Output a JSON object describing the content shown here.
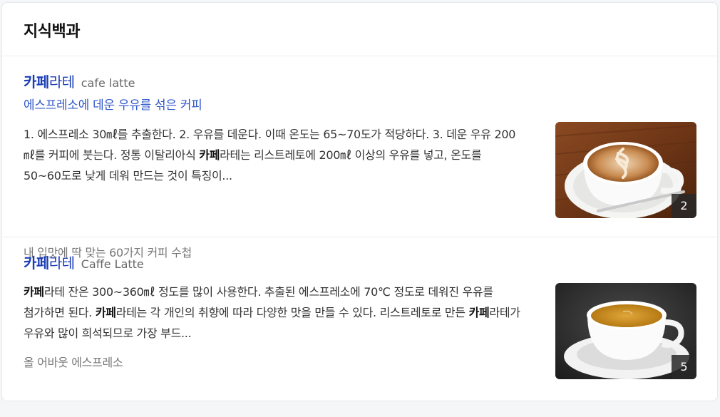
{
  "section_title": "지식백과",
  "items": [
    {
      "title_highlight": "카페",
      "title_rest": "라테",
      "title_sub": "cafe latte",
      "desc": "에스프레소에 데운 우유를 섞은 커피",
      "body": [
        {
          "text": "1. 에스프레소 30㎖를 추출한다. 2. 우유를 데운다. 이때 온도는 65~70도가 적당하다. 3. 데운 우유 200㎖를 커피에 붓는다. 정통 이탈리아식 "
        },
        {
          "text": "카페",
          "bold": true
        },
        {
          "text": "라테는 리스트레토에 200㎖ 이상의 우유를 넣고, 온도를 50~60도로 낮게 데워 만드는 것이 특징이..."
        }
      ],
      "source": "내 입맛에 딱 맞는 60가지 커피 수첩",
      "image_count": "2"
    },
    {
      "title_highlight": "카페",
      "title_rest": "라테",
      "title_sub": "Caffe Latte",
      "desc": "",
      "body": [
        {
          "text": "카페",
          "bold": true
        },
        {
          "text": "라테 잔은 300~360㎖ 정도를 많이 사용한다. 추출된 에스프레소에 70℃ 정도로 데워진 우유를 첨가하면 된다. "
        },
        {
          "text": "카페",
          "bold": true
        },
        {
          "text": "라테는 각 개인의 취향에 따라 다양한 맛을 만들 수 있다. 리스트레토로 만든 "
        },
        {
          "text": "카페",
          "bold": true
        },
        {
          "text": "라테가 우유와 많이 희석되므로 가장 부드..."
        }
      ],
      "source": "올 어바웃 에스프레소",
      "image_count": "5"
    }
  ],
  "colors": {
    "link": "#1b3db6",
    "desc": "#2f58c9",
    "text": "#333333",
    "muted": "#777777"
  }
}
